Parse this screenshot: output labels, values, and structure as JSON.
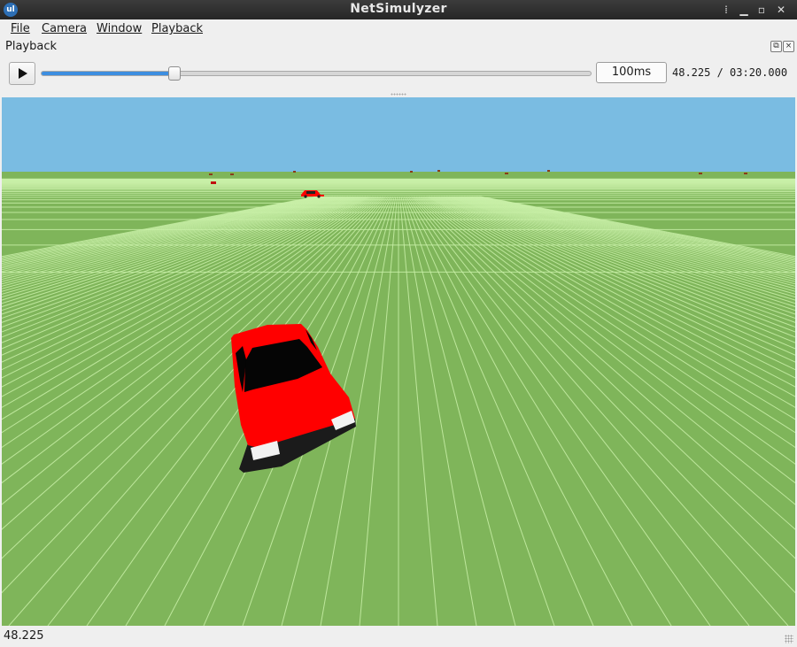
{
  "window": {
    "title": "NetSimulyzer"
  },
  "menu": {
    "items": [
      {
        "label": "File"
      },
      {
        "label": "Camera"
      },
      {
        "label": "Window"
      },
      {
        "label": "Playback"
      }
    ]
  },
  "dock": {
    "title": "Playback"
  },
  "playback": {
    "progress_fraction": 0.2411,
    "step": "100ms",
    "time": "48.225 / 03:20.000"
  },
  "colors": {
    "sky": "#7abce2",
    "ground": "#7fb55a",
    "grid": "#c9f0a8",
    "car": "#ff0000",
    "accent": "#3d8ee0"
  },
  "status": {
    "text": "48.225"
  }
}
